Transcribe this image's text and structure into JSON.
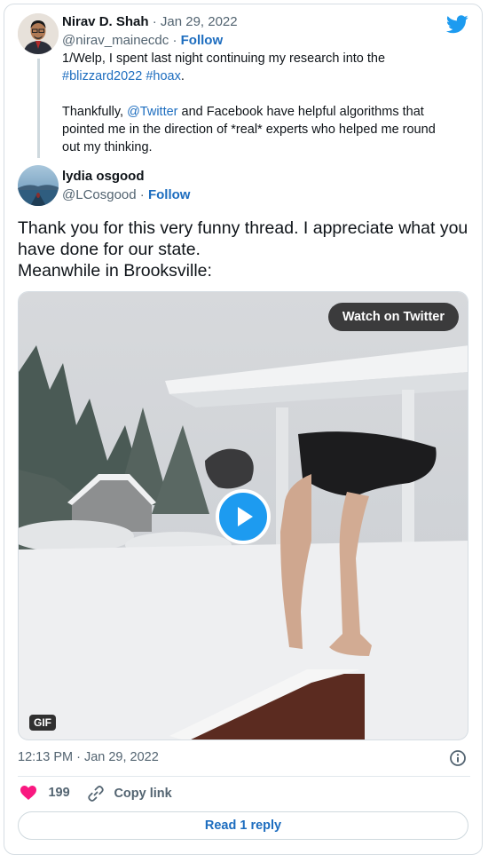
{
  "first_tweet": {
    "author_name": "Nirav D. Shah",
    "separator": "·",
    "date": "Jan 29, 2022",
    "handle": "@nirav_mainecdc",
    "follow_label": "Follow",
    "line1": "1/Welp, I spent last night continuing my research into the",
    "hashtag1": "#blizzard2022",
    "hashtag2": "#hoax",
    "line2_end": ".",
    "para2_start": "Thankfully, ",
    "mention": "@Twitter",
    "para2_rest": " and Facebook have helpful algorithms that",
    "para2_line2": "pointed me in the direction of *real* experts who helped me round",
    "para2_line3": "out my thinking."
  },
  "reply_tweet": {
    "author_name": "lydia osgood",
    "handle": "@LCosgood",
    "separator": "·",
    "follow_label": "Follow",
    "text_line1": "Thank you for this very funny thread. I appreciate what you",
    "text_line2": "have done for our state.",
    "text_line3": "Meanwhile in Brooksville:"
  },
  "media": {
    "watch_label": "Watch on Twitter",
    "badge": "GIF"
  },
  "meta": {
    "timestamp": "12:13 PM · Jan 29, 2022"
  },
  "actions": {
    "like_count": "199",
    "copy_label": "Copy link"
  },
  "footer": {
    "read_reply_label": "Read 1 reply"
  },
  "colors": {
    "accent": "#1d9bf0",
    "link": "#1d6dbf",
    "heart": "#f91880"
  }
}
